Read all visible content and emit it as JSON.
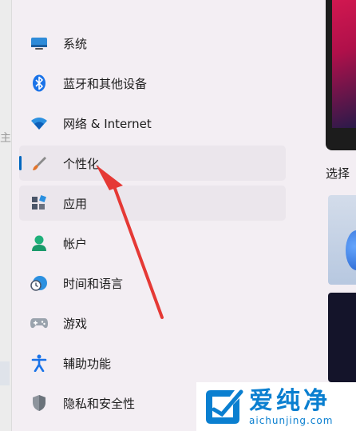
{
  "sidebar": {
    "items": [
      {
        "label": "系统",
        "icon": "display-icon"
      },
      {
        "label": "蓝牙和其他设备",
        "icon": "bluetooth-icon"
      },
      {
        "label": "网络 & Internet",
        "icon": "wifi-icon"
      },
      {
        "label": "个性化",
        "icon": "paintbrush-icon",
        "selected": true
      },
      {
        "label": "应用",
        "icon": "apps-icon"
      },
      {
        "label": "帐户",
        "icon": "person-icon"
      },
      {
        "label": "时间和语言",
        "icon": "clock-globe-icon"
      },
      {
        "label": "游戏",
        "icon": "gamepad-icon"
      },
      {
        "label": "辅助功能",
        "icon": "accessibility-icon"
      },
      {
        "label": "隐私和安全性",
        "icon": "shield-icon"
      }
    ]
  },
  "right_panel": {
    "label": "选择"
  },
  "watermark": {
    "text": "爱纯净",
    "url": "aichunjing.com"
  },
  "colors": {
    "accent": "#0067c0",
    "arrow": "#e53935",
    "selected_bg": "#ebe6ec"
  }
}
